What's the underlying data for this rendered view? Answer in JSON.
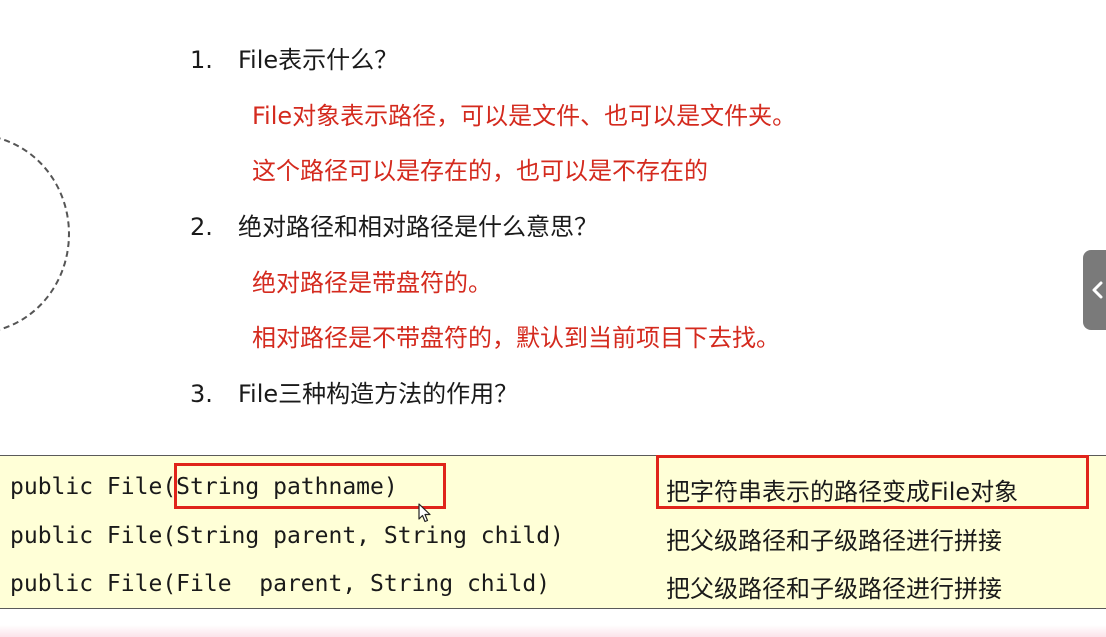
{
  "questions": [
    {
      "number": "1.",
      "text": "File表示什么？",
      "answers": [
        "File对象表示路径，可以是文件、也可以是文件夹。",
        "这个路径可以是存在的，也可以是不存在的"
      ]
    },
    {
      "number": "2.",
      "text": "绝对路径和相对路径是什么意思？",
      "answers": [
        "绝对路径是带盘符的。",
        "相对路径是不带盘符的，默认到当前项目下去找。"
      ]
    },
    {
      "number": "3.",
      "text": "File三种构造方法的作用？",
      "answers": []
    }
  ],
  "constructors": [
    {
      "signature": "public File(String pathname)",
      "description": "把字符串表示的路径变成File对象"
    },
    {
      "signature": "public File(String parent, String child)",
      "description": "把父级路径和子级路径进行拼接"
    },
    {
      "signature": "public File(File  parent, String child)",
      "description": "把父级路径和子级路径进行拼接"
    }
  ],
  "colors": {
    "answer_text": "#d42a1e",
    "highlight_border": "#e0241b",
    "code_background": "#ffffd7"
  },
  "icons": {
    "side_tab": "chevron-left-icon",
    "cursor": "mouse-cursor-icon"
  }
}
